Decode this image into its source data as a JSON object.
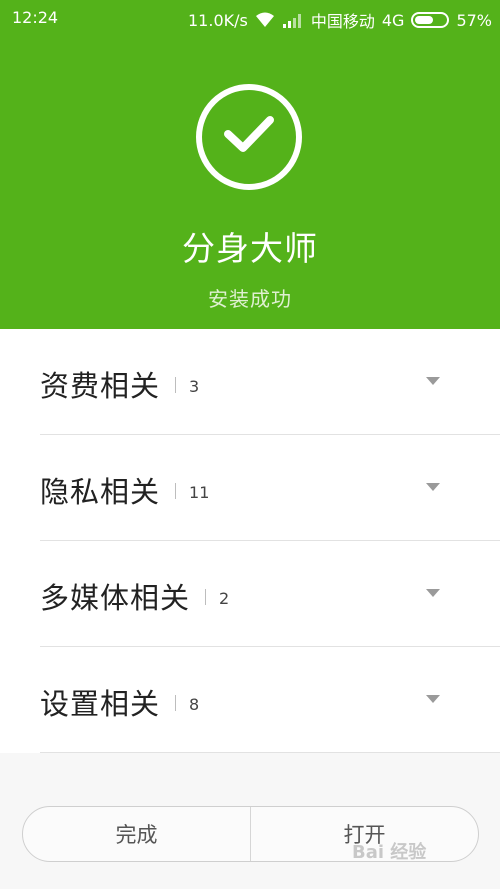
{
  "status_bar": {
    "time": "12:24",
    "speed": "11.0K/s",
    "carrier": "中国移动",
    "network": "4G",
    "battery": "57%",
    "battery_level": 0.57
  },
  "header": {
    "app_name": "分身大师",
    "status": "安装成功",
    "icon": "check-circle-icon"
  },
  "permissions": [
    {
      "label": "资费相关",
      "count": "3"
    },
    {
      "label": "隐私相关",
      "count": "11"
    },
    {
      "label": "多媒体相关",
      "count": "2"
    },
    {
      "label": "设置相关",
      "count": "8"
    }
  ],
  "buttons": {
    "done": "完成",
    "open": "打开"
  },
  "watermark": "Bai 经验",
  "colors": {
    "header_bg": "#54b21a",
    "text": "#222222"
  }
}
